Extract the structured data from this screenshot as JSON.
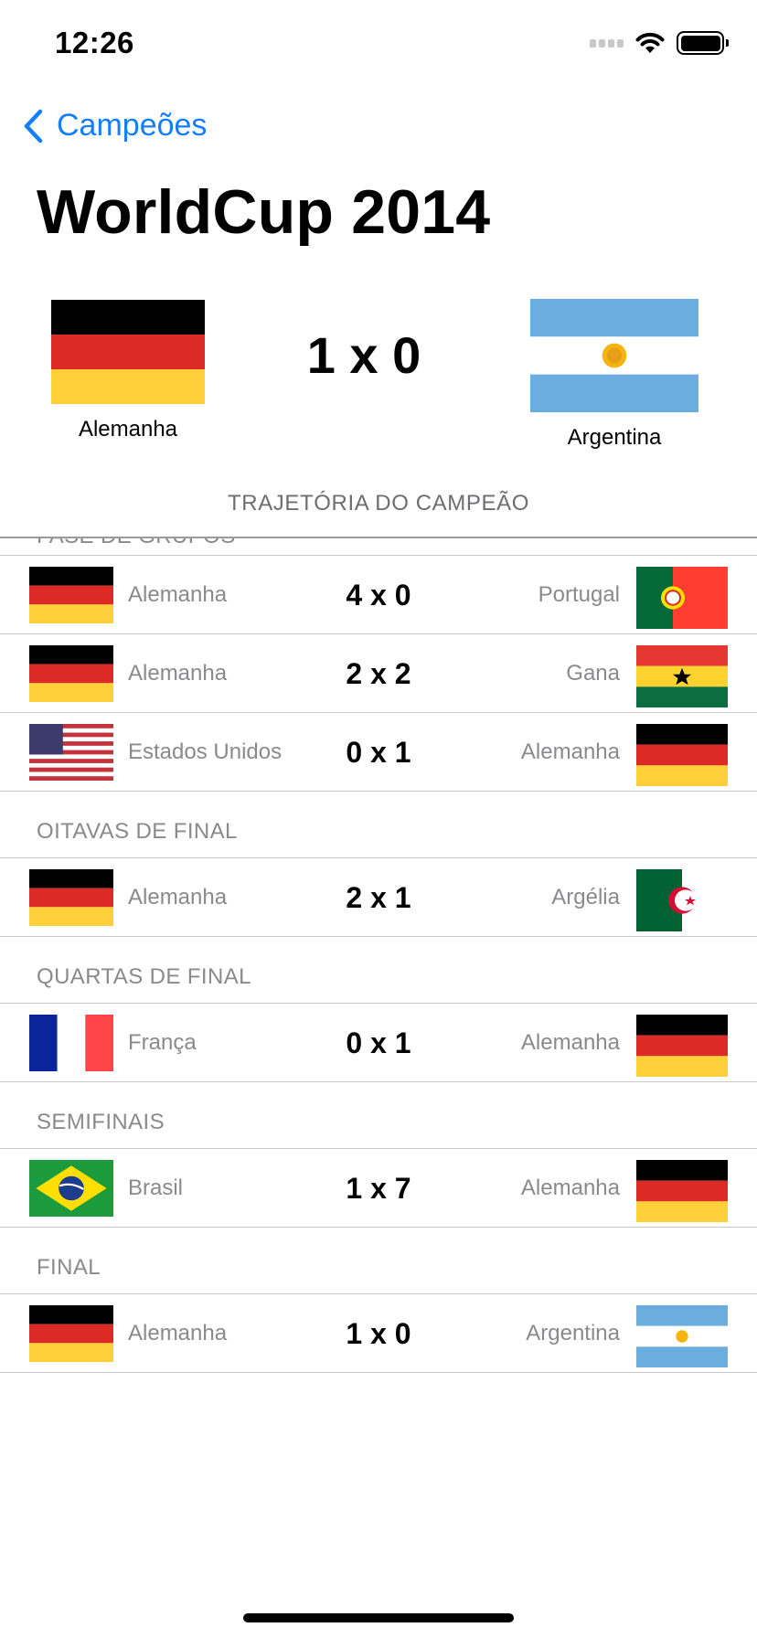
{
  "status_bar": {
    "time": "12:26"
  },
  "nav": {
    "back_label": "Campeões"
  },
  "page": {
    "title": "WorldCup 2014"
  },
  "final_match": {
    "home_team": "Alemanha",
    "away_team": "Argentina",
    "score": "1 x 0",
    "home_flag": "germany-flag-icon",
    "away_flag": "argentina-flag-icon"
  },
  "section_header": "TRAJETÓRIA DO CAMPEÃO",
  "phases": [
    {
      "name": "FASE DE GRUPOS",
      "matches": [
        {
          "home": "Alemanha",
          "away": "Portugal",
          "score": "4 x 0",
          "home_flag": "germany",
          "away_flag": "portugal"
        },
        {
          "home": "Alemanha",
          "away": "Gana",
          "score": "2 x 2",
          "home_flag": "germany",
          "away_flag": "ghana"
        },
        {
          "home": "Estados Unidos",
          "away": "Alemanha",
          "score": "0 x 1",
          "home_flag": "usa",
          "away_flag": "germany"
        }
      ]
    },
    {
      "name": "OITAVAS DE FINAL",
      "matches": [
        {
          "home": "Alemanha",
          "away": "Argélia",
          "score": "2 x 1",
          "home_flag": "germany",
          "away_flag": "algeria"
        }
      ]
    },
    {
      "name": "QUARTAS DE FINAL",
      "matches": [
        {
          "home": "França",
          "away": "Alemanha",
          "score": "0 x 1",
          "home_flag": "france",
          "away_flag": "germany"
        }
      ]
    },
    {
      "name": "SEMIFINAIS",
      "matches": [
        {
          "home": "Brasil",
          "away": "Alemanha",
          "score": "1 x 7",
          "home_flag": "brazil",
          "away_flag": "germany"
        }
      ]
    },
    {
      "name": "FINAL",
      "matches": [
        {
          "home": "Alemanha",
          "away": "Argentina",
          "score": "1 x 0",
          "home_flag": "germany",
          "away_flag": "argentina"
        }
      ]
    }
  ],
  "colors": {
    "accent": "#147EFB",
    "germany": [
      "#000000",
      "#DD0000",
      "#FFCE00"
    ],
    "argentina_blue": "#74ACDF"
  }
}
